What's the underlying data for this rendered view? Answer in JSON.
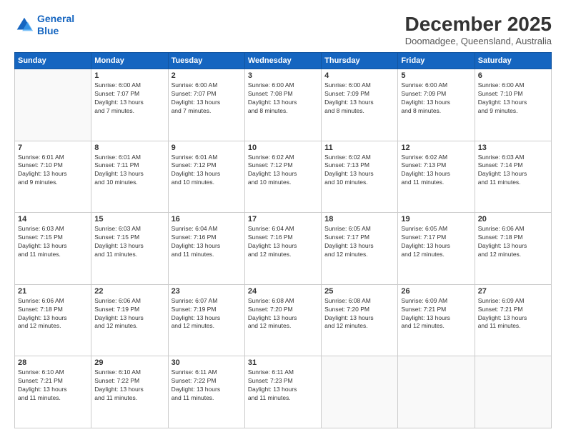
{
  "header": {
    "logo_line1": "General",
    "logo_line2": "Blue",
    "month": "December 2025",
    "location": "Doomadgee, Queensland, Australia"
  },
  "weekdays": [
    "Sunday",
    "Monday",
    "Tuesday",
    "Wednesday",
    "Thursday",
    "Friday",
    "Saturday"
  ],
  "weeks": [
    [
      {
        "day": "",
        "info": ""
      },
      {
        "day": "1",
        "info": "Sunrise: 6:00 AM\nSunset: 7:07 PM\nDaylight: 13 hours\nand 7 minutes."
      },
      {
        "day": "2",
        "info": "Sunrise: 6:00 AM\nSunset: 7:07 PM\nDaylight: 13 hours\nand 7 minutes."
      },
      {
        "day": "3",
        "info": "Sunrise: 6:00 AM\nSunset: 7:08 PM\nDaylight: 13 hours\nand 8 minutes."
      },
      {
        "day": "4",
        "info": "Sunrise: 6:00 AM\nSunset: 7:09 PM\nDaylight: 13 hours\nand 8 minutes."
      },
      {
        "day": "5",
        "info": "Sunrise: 6:00 AM\nSunset: 7:09 PM\nDaylight: 13 hours\nand 8 minutes."
      },
      {
        "day": "6",
        "info": "Sunrise: 6:00 AM\nSunset: 7:10 PM\nDaylight: 13 hours\nand 9 minutes."
      }
    ],
    [
      {
        "day": "7",
        "info": "Sunrise: 6:01 AM\nSunset: 7:10 PM\nDaylight: 13 hours\nand 9 minutes."
      },
      {
        "day": "8",
        "info": "Sunrise: 6:01 AM\nSunset: 7:11 PM\nDaylight: 13 hours\nand 10 minutes."
      },
      {
        "day": "9",
        "info": "Sunrise: 6:01 AM\nSunset: 7:12 PM\nDaylight: 13 hours\nand 10 minutes."
      },
      {
        "day": "10",
        "info": "Sunrise: 6:02 AM\nSunset: 7:12 PM\nDaylight: 13 hours\nand 10 minutes."
      },
      {
        "day": "11",
        "info": "Sunrise: 6:02 AM\nSunset: 7:13 PM\nDaylight: 13 hours\nand 10 minutes."
      },
      {
        "day": "12",
        "info": "Sunrise: 6:02 AM\nSunset: 7:13 PM\nDaylight: 13 hours\nand 11 minutes."
      },
      {
        "day": "13",
        "info": "Sunrise: 6:03 AM\nSunset: 7:14 PM\nDaylight: 13 hours\nand 11 minutes."
      }
    ],
    [
      {
        "day": "14",
        "info": "Sunrise: 6:03 AM\nSunset: 7:15 PM\nDaylight: 13 hours\nand 11 minutes."
      },
      {
        "day": "15",
        "info": "Sunrise: 6:03 AM\nSunset: 7:15 PM\nDaylight: 13 hours\nand 11 minutes."
      },
      {
        "day": "16",
        "info": "Sunrise: 6:04 AM\nSunset: 7:16 PM\nDaylight: 13 hours\nand 11 minutes."
      },
      {
        "day": "17",
        "info": "Sunrise: 6:04 AM\nSunset: 7:16 PM\nDaylight: 13 hours\nand 12 minutes."
      },
      {
        "day": "18",
        "info": "Sunrise: 6:05 AM\nSunset: 7:17 PM\nDaylight: 13 hours\nand 12 minutes."
      },
      {
        "day": "19",
        "info": "Sunrise: 6:05 AM\nSunset: 7:17 PM\nDaylight: 13 hours\nand 12 minutes."
      },
      {
        "day": "20",
        "info": "Sunrise: 6:06 AM\nSunset: 7:18 PM\nDaylight: 13 hours\nand 12 minutes."
      }
    ],
    [
      {
        "day": "21",
        "info": "Sunrise: 6:06 AM\nSunset: 7:18 PM\nDaylight: 13 hours\nand 12 minutes."
      },
      {
        "day": "22",
        "info": "Sunrise: 6:06 AM\nSunset: 7:19 PM\nDaylight: 13 hours\nand 12 minutes."
      },
      {
        "day": "23",
        "info": "Sunrise: 6:07 AM\nSunset: 7:19 PM\nDaylight: 13 hours\nand 12 minutes."
      },
      {
        "day": "24",
        "info": "Sunrise: 6:08 AM\nSunset: 7:20 PM\nDaylight: 13 hours\nand 12 minutes."
      },
      {
        "day": "25",
        "info": "Sunrise: 6:08 AM\nSunset: 7:20 PM\nDaylight: 13 hours\nand 12 minutes."
      },
      {
        "day": "26",
        "info": "Sunrise: 6:09 AM\nSunset: 7:21 PM\nDaylight: 13 hours\nand 12 minutes."
      },
      {
        "day": "27",
        "info": "Sunrise: 6:09 AM\nSunset: 7:21 PM\nDaylight: 13 hours\nand 11 minutes."
      }
    ],
    [
      {
        "day": "28",
        "info": "Sunrise: 6:10 AM\nSunset: 7:21 PM\nDaylight: 13 hours\nand 11 minutes."
      },
      {
        "day": "29",
        "info": "Sunrise: 6:10 AM\nSunset: 7:22 PM\nDaylight: 13 hours\nand 11 minutes."
      },
      {
        "day": "30",
        "info": "Sunrise: 6:11 AM\nSunset: 7:22 PM\nDaylight: 13 hours\nand 11 minutes."
      },
      {
        "day": "31",
        "info": "Sunrise: 6:11 AM\nSunset: 7:23 PM\nDaylight: 13 hours\nand 11 minutes."
      },
      {
        "day": "",
        "info": ""
      },
      {
        "day": "",
        "info": ""
      },
      {
        "day": "",
        "info": ""
      }
    ]
  ]
}
